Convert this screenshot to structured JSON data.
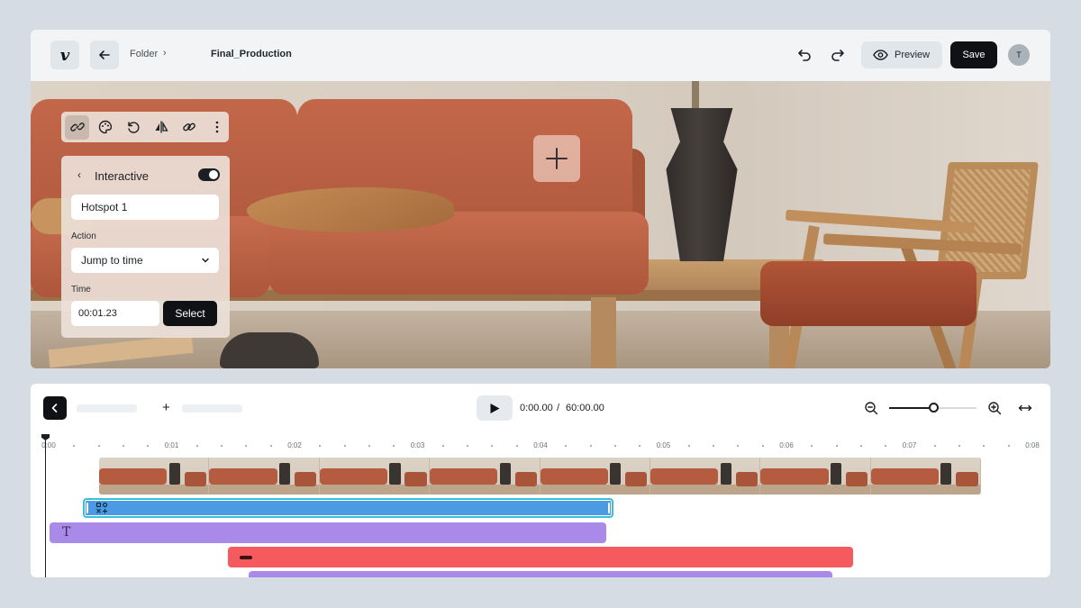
{
  "header": {
    "logo": "v",
    "breadcrumb_folder": "Folder",
    "breadcrumb_chevron": "›",
    "project_title": "Final_Production",
    "preview_label": "Preview",
    "save_label": "Save",
    "avatar_initial": "T"
  },
  "icons": {
    "logo": "vimeo-logo-icon",
    "back": "arrow-left-icon",
    "undo": "undo-icon",
    "redo": "redo-icon",
    "preview": "eye-icon",
    "toolbar": [
      "link-icon",
      "palette-icon",
      "rotate-icon",
      "flip-icon",
      "chain-link-icon",
      "more-vertical-icon"
    ],
    "add_hotspot": "plus-icon",
    "play": "play-icon",
    "zoom_out": "zoom-out-icon",
    "zoom_in": "zoom-in-icon",
    "fit": "fit-width-icon"
  },
  "panel": {
    "back_chevron": "‹",
    "title": "Interactive",
    "toggle_on": true,
    "name_value": "Hotspot 1",
    "action_label": "Action",
    "action_value": "Jump to time",
    "time_label": "Time",
    "time_value": "00:01.23",
    "select_label": "Select"
  },
  "timeline": {
    "add_label": "+",
    "current_time": "0:00.00",
    "separator": "/",
    "total_time": "60:00.00",
    "zoom_level": 0.5,
    "ruler_labels": [
      "0:00",
      "0:01",
      "0:02",
      "0:03",
      "0:04",
      "0:05",
      "0:06",
      "0:07",
      "0:08"
    ],
    "filmstrip_frames": 8,
    "text_track_glyph": "T"
  },
  "colors": {
    "accent_dark": "#0f1115",
    "hotspot_track": "#4a9be3",
    "hotspot_outline": "#39c0d6",
    "text_track": "#a98ae8",
    "shape_track": "#f45a5e",
    "sofa": "#b55c40"
  }
}
